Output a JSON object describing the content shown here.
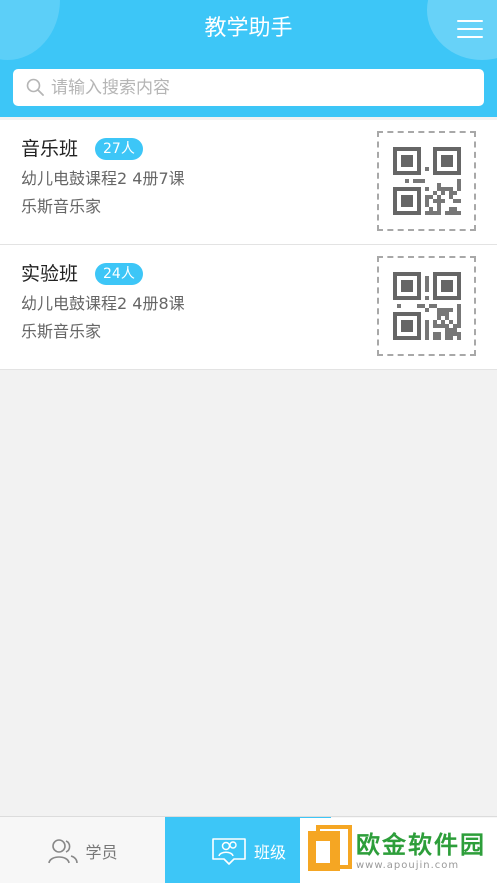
{
  "header": {
    "title": "教学助手"
  },
  "search": {
    "placeholder": "请输入搜索内容"
  },
  "classes": [
    {
      "name": "音乐班",
      "count": "27人",
      "course": "幼儿电鼓课程2 4册7课",
      "org": "乐斯音乐家"
    },
    {
      "name": "实验班",
      "count": "24人",
      "course": "幼儿电鼓课程2 4册8课",
      "org": "乐斯音乐家"
    }
  ],
  "tabs": {
    "students": "学员",
    "classes": "班级"
  },
  "watermark": {
    "text": "欧金软件园",
    "url": "www.apoujin.com"
  },
  "colors": {
    "accent": "#3dc6f7",
    "watermark_green": "#2d9e3a"
  }
}
